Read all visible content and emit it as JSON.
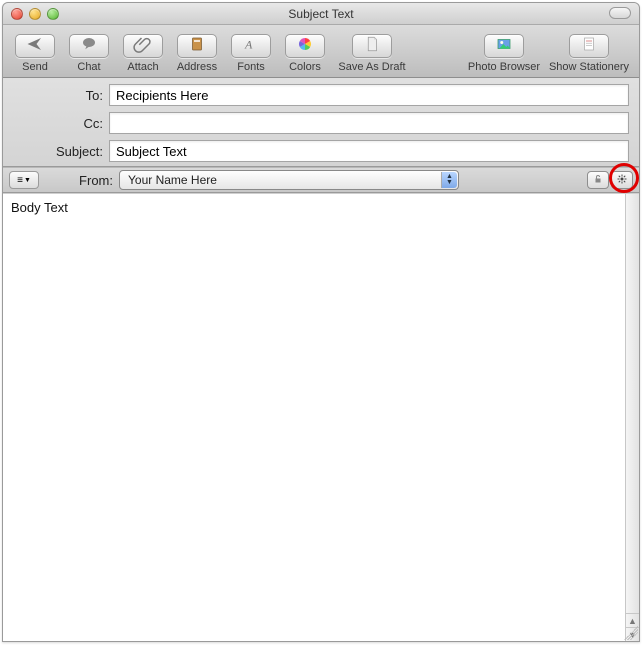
{
  "window": {
    "title": "Subject Text"
  },
  "toolbar": {
    "send": "Send",
    "chat": "Chat",
    "attach": "Attach",
    "address": "Address",
    "fonts": "Fonts",
    "colors": "Colors",
    "save_as_draft": "Save As Draft",
    "photo_browser": "Photo Browser",
    "show_stationery": "Show Stationery"
  },
  "headers": {
    "to_label": "To:",
    "to_value": "Recipients Here",
    "cc_label": "Cc:",
    "cc_value": "",
    "subject_label": "Subject:",
    "subject_value": "Subject Text"
  },
  "from_bar": {
    "label": "From:",
    "selected": "Your Name Here"
  },
  "body": {
    "text": "Body Text"
  }
}
